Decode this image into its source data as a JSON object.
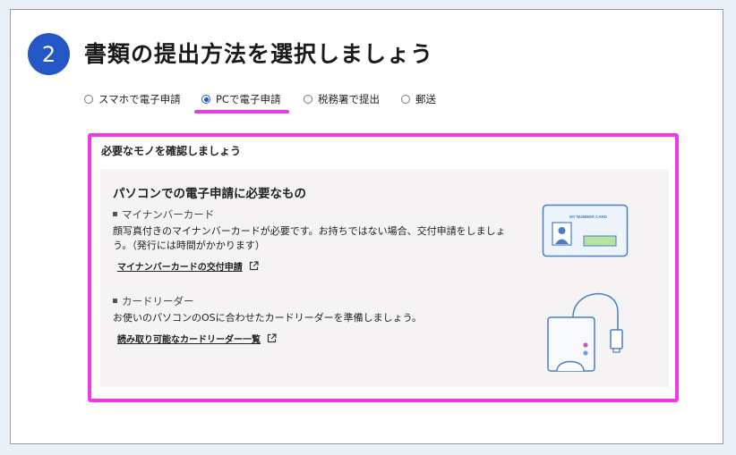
{
  "step": {
    "number": "2",
    "title": "書類の提出方法を選択しましょう"
  },
  "methods": [
    {
      "label": "スマホで電子申請",
      "selected": false
    },
    {
      "label": "PCで電子申請",
      "selected": true
    },
    {
      "label": "税務署で提出",
      "selected": false
    },
    {
      "label": "郵送",
      "selected": false
    }
  ],
  "panel": {
    "title": "必要なモノを確認しましょう",
    "heading": "パソコンでの電子申請に必要なもの",
    "items": [
      {
        "heading": "マイナンバーカード",
        "desc_line1": "顔写真付きのマイナンバーカードが必要です。お持ちではない場合、交付申請をしましょ",
        "desc_line2": "う。（発行には時間がかかります）",
        "link": "マイナンバーカードの交付申請",
        "image_label": "MY NUMBER CARD"
      },
      {
        "heading": "カードリーダー",
        "desc_line1": "お使いのパソコンのOSに合わせたカードリーダーを準備しましょう。",
        "link": "読み取り可能なカードリーダー一覧"
      }
    ]
  },
  "colors": {
    "accent": "#2457c5",
    "highlight": "#f038e8",
    "background": "#e9f0f8",
    "illustration": "#4a7ec4",
    "card_fill": "#eef4fb",
    "card_bar": "#b7e3a1"
  }
}
